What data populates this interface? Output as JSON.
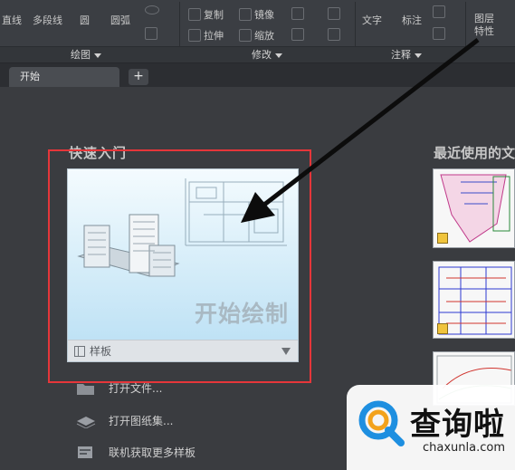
{
  "ribbon": {
    "draw_tools": [
      "直线",
      "多段线",
      "圆",
      "圆弧"
    ],
    "modify_tools": [
      "复制",
      "镜像",
      "拉伸",
      "缩放"
    ],
    "annotate_tools": [
      "文字",
      "标注"
    ],
    "right_tool_lines": [
      "图层",
      "特性"
    ],
    "panels": [
      "绘图",
      "修改",
      "注释"
    ]
  },
  "tabs": {
    "active_label": "开始",
    "add_label": "+"
  },
  "quick_start": {
    "heading": "快速入门",
    "card_title": "开始绘制",
    "template_label": "样板",
    "links": [
      "打开文件...",
      "打开图纸集...",
      "联机获取更多样板"
    ]
  },
  "recent": {
    "heading": "最近使用的文"
  },
  "watermark": {
    "cn": "查询啦",
    "en": "chaxunla.com"
  },
  "colors": {
    "highlight_border": "#e5363a",
    "background": "#3a3c40",
    "ribbon": "#3b3e43",
    "card_gradient_bottom": "#bfe2f5"
  }
}
